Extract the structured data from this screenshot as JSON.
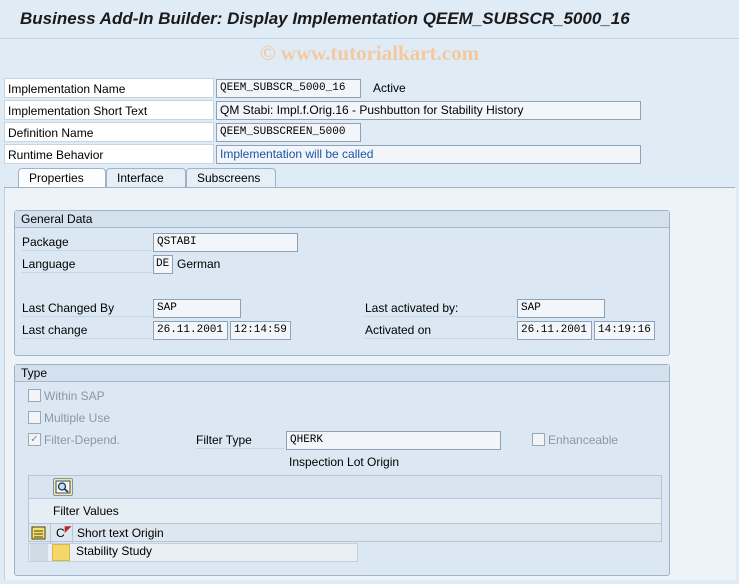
{
  "window": {
    "title": "Business Add-In Builder: Display Implementation QEEM_SUBSCR_5000_16"
  },
  "watermark": "© www.tutorialkart.com",
  "header": {
    "impl_name_label": "Implementation Name",
    "impl_name_value": "QEEM_SUBSCR_5000_16",
    "impl_status": "Active",
    "short_text_label": "Implementation Short Text",
    "short_text_value": "QM Stabi: Impl.f.Orig.16 - Pushbutton for Stability History",
    "def_name_label": "Definition Name",
    "def_name_value": "QEEM_SUBSCREEN_5000",
    "runtime_label": "Runtime Behavior",
    "runtime_value": "Implementation will be called"
  },
  "tabs": [
    {
      "label": "Properties"
    },
    {
      "label": "Interface"
    },
    {
      "label": "Subscreens"
    }
  ],
  "general": {
    "title": "General Data",
    "package_label": "Package",
    "package_value": "QSTABI",
    "language_label": "Language",
    "language_code": "DE",
    "language_name": "German",
    "changed_by_label": "Last Changed By",
    "changed_by_value": "SAP",
    "last_change_label": "Last change",
    "last_change_date": "26.11.2001",
    "last_change_time": "12:14:59",
    "activated_by_label": "Last activated by:",
    "activated_by_value": "SAP",
    "activated_on_label": "Activated on",
    "activated_on_date": "26.11.2001",
    "activated_on_time": "14:19:16"
  },
  "type": {
    "title": "Type",
    "within_sap": "Within SAP",
    "multiple_use": "Multiple Use",
    "filter_depend": "Filter-Depend.",
    "filter_type_label": "Filter Type",
    "filter_type_value": "QHERK",
    "filter_type_desc": "Inspection Lot Origin",
    "enhanceable": "Enhanceable"
  },
  "filter_table": {
    "caption": "Filter Values",
    "sort_mark": "C",
    "column_header": "Short text Origin",
    "rows": [
      {
        "text": "Stability Study"
      }
    ]
  },
  "colors": {
    "background": "#dfebf5",
    "link": "#1a55a5",
    "input_highlight": "#f5d66a"
  }
}
